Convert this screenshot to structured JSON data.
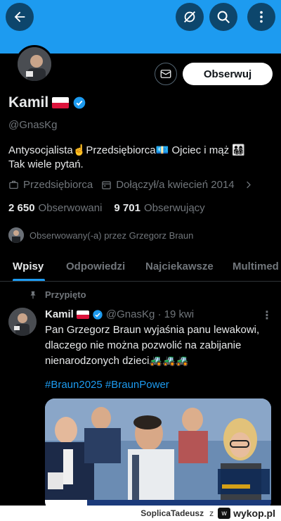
{
  "header": {
    "back_icon": "arrow-left-icon",
    "icons": [
      "no-notifications-icon",
      "search-icon",
      "more-vertical-icon"
    ],
    "banner_color": "#1d9bf0"
  },
  "profile": {
    "name": "Kamil",
    "handle": "@GnasKg",
    "bio_line1": "Antysocjalista☝️Przedsiębiorca💶 Ojciec i mąż 👨‍👩‍👧‍👦",
    "bio_line2": "Tak wiele pytań.",
    "category": "Przedsiębiorca",
    "joined": "Dołączył/a kwiecień 2014",
    "following_count": "2 650",
    "following_label": "Obserwowani",
    "followers_count": "9 701",
    "followers_label": "Obserwujący",
    "followed_by": "Obserwowany(-a) przez Grzegorz Braun",
    "follow_label": "Obserwuj",
    "accent": "#1d9bf0"
  },
  "tabs": [
    {
      "label": "Wpisy",
      "active": true
    },
    {
      "label": "Odpowiedzi",
      "active": false
    },
    {
      "label": "Najciekawsze",
      "active": false
    },
    {
      "label": "Multimed",
      "active": false
    }
  ],
  "pinned_tweet": {
    "pinned_label": "Przypięto",
    "name": "Kamil",
    "handle_time": "@GnasKg · 19 kwi",
    "text_line1": "Pan Grzegorz Braun wyjaśnia panu lewakowi,",
    "text_line2": "dlaczego nie można pozwolić na zabijanie",
    "text_line3": "nienarodzonych dzieci🚜🚜🚜",
    "hashtags": "#Braun2025 #BraunPower",
    "media_caption": "INTERWENCJA OBYWATELSKA POSŁÓW KONFEDERACJI"
  },
  "footer": {
    "user": "SoplicaTadeusz",
    "suffix": "z",
    "brand": "wykop.pl"
  }
}
